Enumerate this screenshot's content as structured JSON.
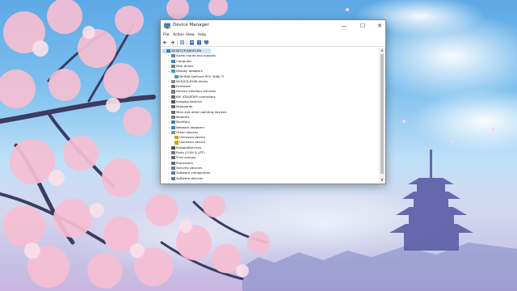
{
  "window": {
    "title": "Device Manager",
    "minimize_glyph": "—",
    "maximize_glyph": "☐",
    "close_glyph": "✕"
  },
  "menu": [
    "File",
    "Action",
    "View",
    "Help"
  ],
  "toolbar": [
    {
      "icon": "back-arrow-icon",
      "color": "#3a3a3a"
    },
    {
      "icon": "forward-arrow-icon",
      "color": "#3a3a3a"
    },
    {
      "icon": "device-view-icon",
      "color": "#6d8fb8"
    },
    {
      "icon": "properties-icon",
      "color": "#2b6cb0"
    },
    {
      "icon": "help-icon",
      "color": "#2b6cb0"
    },
    {
      "icon": "monitor-scan-icon",
      "color": "#3d7bc4"
    }
  ],
  "tree": {
    "root": {
      "label": "DESKTOP-B0SPCEN",
      "expander": "⌄",
      "icon": "computer-icon"
    },
    "items": [
      {
        "label": "Audio inputs and outputs",
        "expanded": false,
        "icon": "speaker-icon",
        "color": "#6f7d8a"
      },
      {
        "label": "Computer",
        "expanded": false,
        "icon": "computer-icon",
        "color": "#3b7fc4"
      },
      {
        "label": "Disk drives",
        "expanded": false,
        "icon": "disk-icon",
        "color": "#7a7a7a"
      },
      {
        "label": "Display adapters",
        "expanded": true,
        "icon": "display-adapter-icon",
        "color": "#3aa0a6"
      },
      {
        "label": "NVIDIA GeForce RTX 3080 Ti",
        "child": true,
        "icon": "display-adapter-icon",
        "color": "#3aa0a6"
      },
      {
        "label": "DVD/CD-ROM drives",
        "expanded": false,
        "icon": "dvd-icon",
        "color": "#8a8a8a"
      },
      {
        "label": "Firmware",
        "expanded": false,
        "icon": "chip-icon",
        "color": "#5b6f7f"
      },
      {
        "label": "Human Interface Devices",
        "expanded": false,
        "icon": "hid-icon",
        "color": "#7a7a7a"
      },
      {
        "label": "IDE ATA/ATAPI controllers",
        "expanded": false,
        "icon": "controller-icon",
        "color": "#5a6b7a"
      },
      {
        "label": "Imaging devices",
        "expanded": false,
        "icon": "camera-icon",
        "color": "#555555"
      },
      {
        "label": "Keyboards",
        "expanded": false,
        "icon": "keyboard-icon",
        "color": "#6b6b6b"
      },
      {
        "label": "Mice and other pointing devices",
        "expanded": false,
        "icon": "mouse-icon",
        "color": "#6b6b6b"
      },
      {
        "label": "Modems",
        "expanded": false,
        "icon": "modem-icon",
        "color": "#6a7a88"
      },
      {
        "label": "Monitors",
        "expanded": false,
        "icon": "monitor-icon",
        "color": "#3b7fc4"
      },
      {
        "label": "Network adapters",
        "expanded": false,
        "icon": "network-icon",
        "color": "#3b7fc4"
      },
      {
        "label": "Other devices",
        "expanded": true,
        "icon": "unknown-device-icon",
        "color": "#8a8a8a"
      },
      {
        "label": "Unknown device",
        "child": true,
        "icon": "warning-device-icon",
        "color": "#d4a017"
      },
      {
        "label": "Unknown device",
        "child": true,
        "icon": "warning-device-icon",
        "color": "#d4a017"
      },
      {
        "label": "PortableDevices",
        "expanded": false,
        "icon": "portable-device-icon",
        "color": "#4a4a4a"
      },
      {
        "label": "Ports (COM & LPT)",
        "expanded": false,
        "icon": "port-icon",
        "color": "#6b7b8a"
      },
      {
        "label": "Print queues",
        "expanded": false,
        "icon": "printer-icon",
        "color": "#6b6b6b"
      },
      {
        "label": "Processors",
        "expanded": false,
        "icon": "processor-icon",
        "color": "#5b6f7f"
      },
      {
        "label": "Security devices",
        "expanded": false,
        "icon": "security-icon",
        "color": "#6a7a88"
      },
      {
        "label": "Software components",
        "expanded": false,
        "icon": "component-icon",
        "color": "#5a7fa8"
      },
      {
        "label": "Software devices",
        "expanded": false,
        "icon": "software-device-icon",
        "color": "#5a7fa8"
      }
    ]
  }
}
